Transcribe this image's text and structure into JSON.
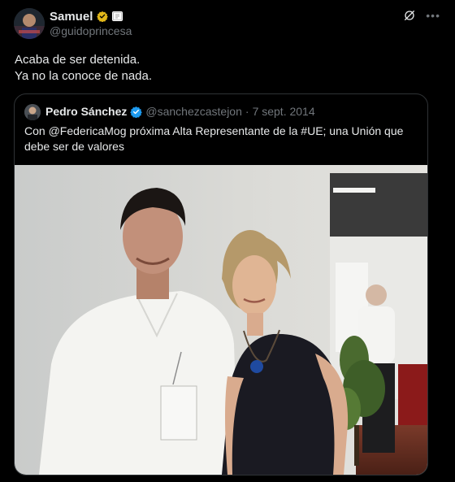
{
  "tweet": {
    "author_name": "Samuel",
    "author_handle": "@guidoprincesa",
    "text_line1": "Acaba de ser detenida.",
    "text_line2": "Ya no la conoce de nada."
  },
  "quoted": {
    "author_name": "Pedro Sánchez",
    "author_handle": "@sanchezcastejon",
    "separator": "·",
    "date": "7 sept. 2014",
    "text_pre": "Con ",
    "mention": "@FedericaMog",
    "text_mid": " próxima Alta Representante de la ",
    "hashtag": "#UE",
    "text_post": "; una Unión que debe ser de valores"
  },
  "colors": {
    "background": "#000000",
    "text": "#e7e9ea",
    "secondary": "#71767b",
    "verified_gold": "#e2b719",
    "verified_blue": "#1d9bf0"
  },
  "icons": {
    "gold_badge": "verified-gold-icon",
    "affiliate": "affiliate-flag-icon",
    "grok": "grok-icon",
    "more": "more-icon",
    "blue_badge": "verified-blue-icon"
  }
}
